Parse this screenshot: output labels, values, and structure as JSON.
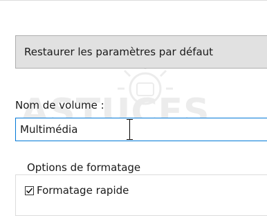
{
  "dialog": {
    "restore_button_label": "Restaurer les paramètres par défaut",
    "volume_label": "Nom de volume :",
    "volume_value": "Multimédia",
    "format_options_title": "Options de formatage",
    "quick_format_label": "Formatage rapide",
    "quick_format_checked": true
  },
  "watermark": {
    "text": "ASTUCES"
  },
  "colors": {
    "focus_border": "#0078d7",
    "button_background": "#e1e1e1"
  }
}
